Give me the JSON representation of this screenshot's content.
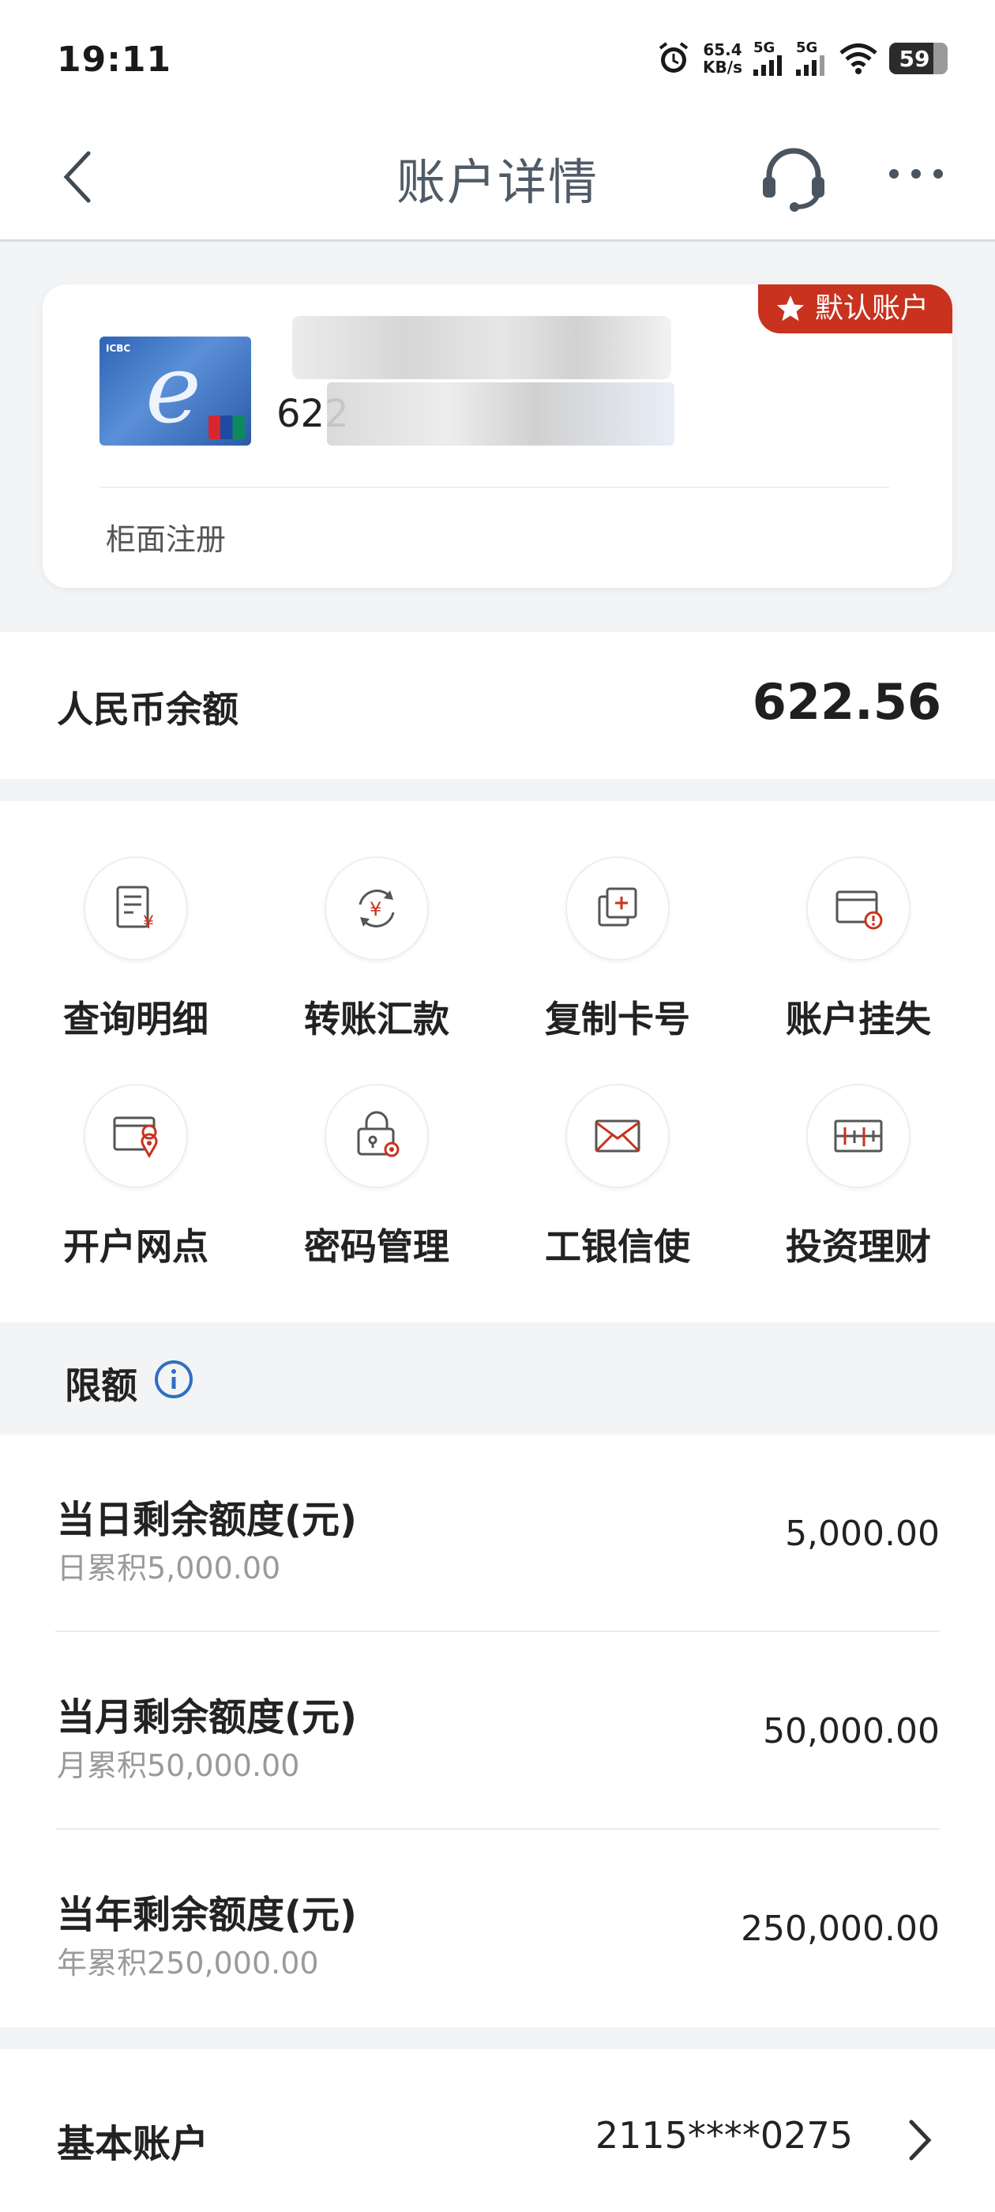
{
  "status_bar": {
    "time": "19:11",
    "net_speed_value": "65.4",
    "net_speed_unit": "KB/s",
    "sim1": "5G",
    "sim2": "5G",
    "battery": "59"
  },
  "header": {
    "title": "账户详情",
    "back_icon": "chevron-left-icon",
    "service_icon": "headset-icon",
    "more_icon": "more-dots-icon"
  },
  "card": {
    "badge": "默认账户",
    "card_number_prefix": "622",
    "register_type": "柜面注册"
  },
  "balance": {
    "label": "人民币余额",
    "value": "622.56"
  },
  "actions": [
    {
      "label": "查询明细",
      "icon": "statement-icon"
    },
    {
      "label": "转账汇款",
      "icon": "transfer-icon"
    },
    {
      "label": "复制卡号",
      "icon": "copy-icon"
    },
    {
      "label": "账户挂失",
      "icon": "report-loss-icon"
    },
    {
      "label": "开户网点",
      "icon": "branch-location-icon"
    },
    {
      "label": "密码管理",
      "icon": "password-icon"
    },
    {
      "label": "工银信使",
      "icon": "mail-icon"
    },
    {
      "label": "投资理财",
      "icon": "investment-icon"
    }
  ],
  "limits": {
    "title": "限额",
    "rows": [
      {
        "title": "当日剩余额度(元)",
        "sub": "日累积5,000.00",
        "value": "5,000.00"
      },
      {
        "title": "当月剩余额度(元)",
        "sub": "月累积50,000.00",
        "value": "50,000.00"
      },
      {
        "title": "当年剩余额度(元)",
        "sub": "年累积250,000.00",
        "value": "250,000.00"
      }
    ]
  },
  "basic_account": {
    "label": "基本账户",
    "value": "2115****0275"
  },
  "colors": {
    "accent_red": "#c8321e",
    "info_blue": "#2f6fc4"
  }
}
